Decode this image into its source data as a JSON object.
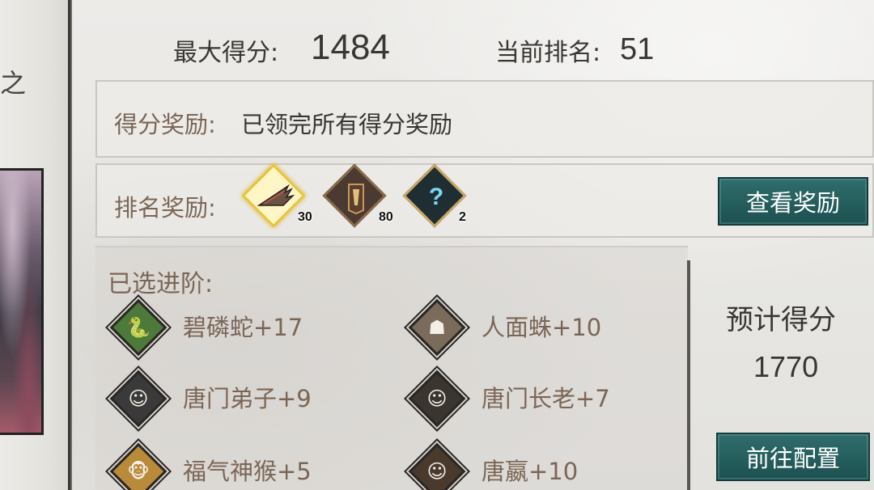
{
  "left": {
    "partial_char": "之"
  },
  "stats": {
    "max_score_label": "最大得分:",
    "max_score_value": "1484",
    "rank_label": "当前排名:",
    "rank_value": "51"
  },
  "score_reward": {
    "label": "得分奖励:",
    "text": "已领完所有得分奖励"
  },
  "rank_reward": {
    "label": "排名奖励:",
    "items": [
      {
        "icon": "claws-icon",
        "count": "30"
      },
      {
        "icon": "tablet-icon",
        "count": "80"
      },
      {
        "icon": "mystery-box-icon",
        "count": "2"
      }
    ],
    "view_button": "查看奖励"
  },
  "advancements": {
    "title": "已选进阶:",
    "items": [
      {
        "name": "碧磷蛇+17",
        "icon": "green-snake-icon",
        "color": "#4d7a3a"
      },
      {
        "name": "人面蛛+10",
        "icon": "masked-spider-icon",
        "color": "#7a6b5a"
      },
      {
        "name": "唐门弟子+9",
        "icon": "disciple-portrait-icon",
        "color": "#3a3a3a"
      },
      {
        "name": "唐门长老+7",
        "icon": "elder-portrait-icon",
        "color": "#3b3530"
      },
      {
        "name": "福气神猴+5",
        "icon": "monkey-icon",
        "color": "#b98a3a"
      },
      {
        "name": "唐嬴+10",
        "icon": "tang-ying-portrait-icon",
        "color": "#4a3a2e"
      }
    ]
  },
  "estimate": {
    "label": "预计得分",
    "value": "1770",
    "goto_button": "前往配置"
  },
  "colors": {
    "accent_teal": "#1c5150",
    "label_brown": "#7b6656",
    "text_dark": "#3a3633"
  }
}
